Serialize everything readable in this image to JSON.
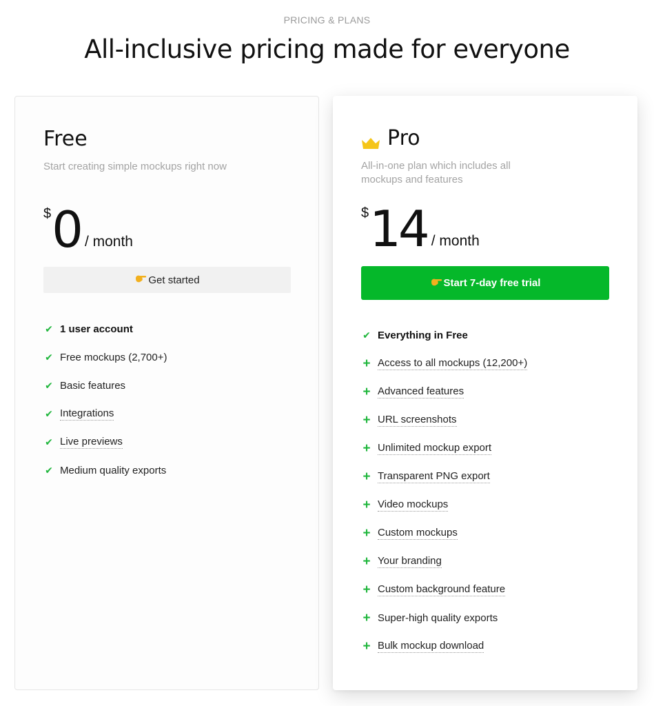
{
  "header": {
    "eyebrow": "PRICING & PLANS",
    "title": "All-inclusive pricing made for everyone"
  },
  "plans": [
    {
      "name": "Free",
      "description": "Start creating simple mockups right now",
      "currency": "$",
      "price": "0",
      "period": "/ month",
      "cta_icon": "pointing-hand-icon",
      "cta_label": "Get started",
      "features": [
        {
          "icon": "check-icon",
          "label": "1 user account",
          "bold": true,
          "dotted": false
        },
        {
          "icon": "check-icon",
          "label": "Free mockups (2,700+)",
          "bold": false,
          "dotted": false
        },
        {
          "icon": "check-icon",
          "label": "Basic features",
          "bold": false,
          "dotted": false
        },
        {
          "icon": "check-icon",
          "label": "Integrations",
          "bold": false,
          "dotted": true
        },
        {
          "icon": "check-icon",
          "label": "Live previews",
          "bold": false,
          "dotted": true
        },
        {
          "icon": "check-icon",
          "label": "Medium quality exports",
          "bold": false,
          "dotted": false
        }
      ]
    },
    {
      "name": "Pro",
      "badge_icon": "crown-icon",
      "description": "All-in-one plan which includes all mockups and features",
      "currency": "$",
      "price": "14",
      "period": "/ month",
      "cta_icon": "pointing-hand-icon",
      "cta_label": "Start 7-day free trial",
      "accent_color": "#05b82a",
      "features": [
        {
          "icon": "check-icon",
          "label": "Everything in Free",
          "bold": true,
          "dotted": false
        },
        {
          "icon": "plus-icon",
          "label": "Access to all mockups (12,200+)",
          "bold": false,
          "dotted": true
        },
        {
          "icon": "plus-icon",
          "label": "Advanced features",
          "bold": false,
          "dotted": true
        },
        {
          "icon": "plus-icon",
          "label": "URL screenshots",
          "bold": false,
          "dotted": true
        },
        {
          "icon": "plus-icon",
          "label": "Unlimited mockup export",
          "bold": false,
          "dotted": true
        },
        {
          "icon": "plus-icon",
          "label": "Transparent PNG export",
          "bold": false,
          "dotted": true
        },
        {
          "icon": "plus-icon",
          "label": "Video mockups",
          "bold": false,
          "dotted": true
        },
        {
          "icon": "plus-icon",
          "label": "Custom mockups",
          "bold": false,
          "dotted": true
        },
        {
          "icon": "plus-icon",
          "label": "Your branding",
          "bold": false,
          "dotted": true
        },
        {
          "icon": "plus-icon",
          "label": "Custom background feature",
          "bold": false,
          "dotted": true
        },
        {
          "icon": "plus-icon",
          "label": "Super-high quality exports",
          "bold": false,
          "dotted": false
        },
        {
          "icon": "plus-icon",
          "label": "Bulk mockup download",
          "bold": false,
          "dotted": true
        }
      ]
    }
  ]
}
